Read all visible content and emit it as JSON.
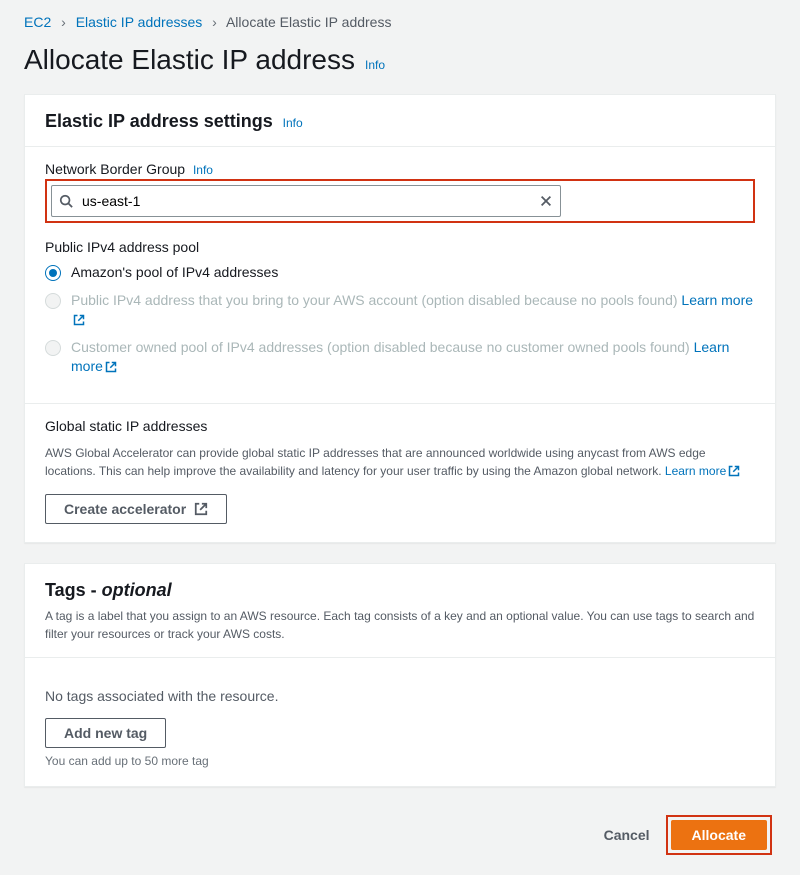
{
  "breadcrumb": {
    "root": "EC2",
    "mid": "Elastic IP addresses",
    "current": "Allocate Elastic IP address"
  },
  "page": {
    "title": "Allocate Elastic IP address",
    "info": "Info"
  },
  "settings": {
    "heading": "Elastic IP address settings",
    "info": "Info",
    "nbg_label": "Network Border Group",
    "nbg_info": "Info",
    "search_value": "us-east-1",
    "pool_label": "Public IPv4 address pool",
    "radio1": "Amazon's pool of IPv4 addresses",
    "radio2": "Public IPv4 address that you bring to your AWS account (option disabled because no pools found) ",
    "radio3": "Customer owned pool of IPv4 addresses (option disabled because no customer owned pools found) ",
    "learn_more": "Learn more"
  },
  "ga": {
    "heading": "Global static IP addresses",
    "desc_pre": "AWS Global Accelerator can provide global static IP addresses that are announced worldwide using anycast from AWS edge locations. This can help improve the availability and latency for your user traffic by using the Amazon global network. ",
    "learn_more": "Learn more",
    "button": "Create accelerator"
  },
  "tags": {
    "heading_pre": "Tags - ",
    "heading_opt": "optional",
    "desc": "A tag is a label that you assign to an AWS resource. Each tag consists of a key and an optional value. You can use tags to search and filter your resources or track your AWS costs.",
    "empty": "No tags associated with the resource.",
    "add_button": "Add new tag",
    "hint": "You can add up to 50 more tag"
  },
  "footer": {
    "cancel": "Cancel",
    "allocate": "Allocate"
  }
}
